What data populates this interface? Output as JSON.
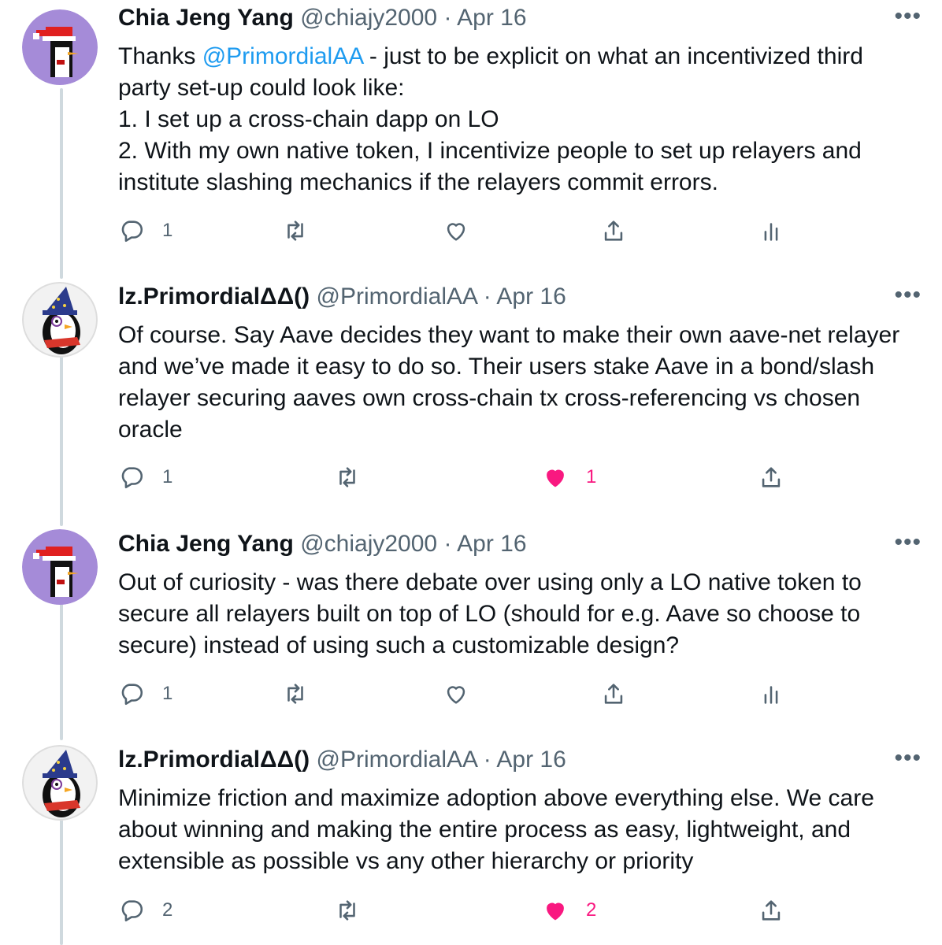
{
  "tweets": [
    {
      "name": "Chia Jeng Yang",
      "handle": "@chiajy2000",
      "date": "Apr 16",
      "avatar": "santa-penguin",
      "lines": {
        "l1_pre": "Thanks ",
        "l1_mention": "@PrimordialAA",
        "l1_post": "  - just to be explicit on what an incentivized third party set-up could look like:",
        "l2": "1. I set up a cross-chain dapp on LO",
        "l3": "2. With my own native token, I incentivize people to set up relayers and institute slashing mechanics if the relayers commit errors."
      },
      "replies": "1",
      "retweets": "",
      "likes": "",
      "liked": false
    },
    {
      "name": "lz.PrimordialΔΔ()",
      "handle": "@PrimordialAA",
      "date": "Apr 16",
      "avatar": "wizard-penguin",
      "text": "Of course. Say Aave decides they want to make their own aave-net relayer and we’ve made it easy to do so. Their users stake Aave in a bond/slash relayer securing aaves own cross-chain tx cross-referencing vs chosen oracle",
      "replies": "1",
      "retweets": "",
      "likes": "1",
      "liked": true
    },
    {
      "name": "Chia Jeng Yang",
      "handle": "@chiajy2000",
      "date": "Apr 16",
      "avatar": "santa-penguin",
      "text": "Out of curiosity - was there debate over using only a LO native token to secure all relayers built on top of LO (should for e.g. Aave so choose to secure) instead of using such a customizable design?",
      "replies": "1",
      "retweets": "",
      "likes": "",
      "liked": false
    },
    {
      "name": "lz.PrimordialΔΔ()",
      "handle": "@PrimordialAA",
      "date": "Apr 16",
      "avatar": "wizard-penguin",
      "text": "Minimize friction and maximize adoption above everything else. We care about winning and making the entire process as easy, lightweight, and extensible as possible vs any other hierarchy or priority",
      "replies": "2",
      "retweets": "",
      "likes": "2",
      "liked": true
    }
  ],
  "ui": {
    "separator": "·",
    "more": "•••",
    "colors": {
      "link": "#1d9bf0",
      "like": "#f91880",
      "muted": "#536471",
      "text": "#0f1419",
      "thread": "#cfd9de"
    },
    "icons": [
      "reply-icon",
      "retweet-icon",
      "like-icon",
      "share-icon",
      "analytics-icon",
      "more-icon"
    ]
  }
}
